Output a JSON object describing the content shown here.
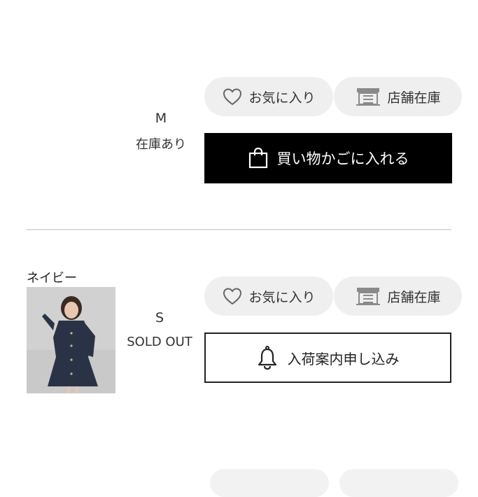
{
  "rows": [
    {
      "color_name": "",
      "size": "M",
      "stock": "在庫あり",
      "favorite_label": "お気に入り",
      "store_label": "店舗在庫",
      "cart_label": "買い物かごに入れる"
    },
    {
      "color_name": "ネイビー",
      "size": "S",
      "stock": "SOLD OUT",
      "favorite_label": "お気に入り",
      "store_label": "店舗在庫",
      "notify_label": "入荷案内申し込み"
    }
  ],
  "colors": {
    "pill_bg": "#efefef",
    "cart_bg": "#000000",
    "divider": "#dcdcdc",
    "navy": "#2a3346"
  },
  "icons": {
    "favorite": "heart-icon",
    "store": "store-icon",
    "cart": "shopping-bag-icon",
    "notify": "bell-icon"
  }
}
